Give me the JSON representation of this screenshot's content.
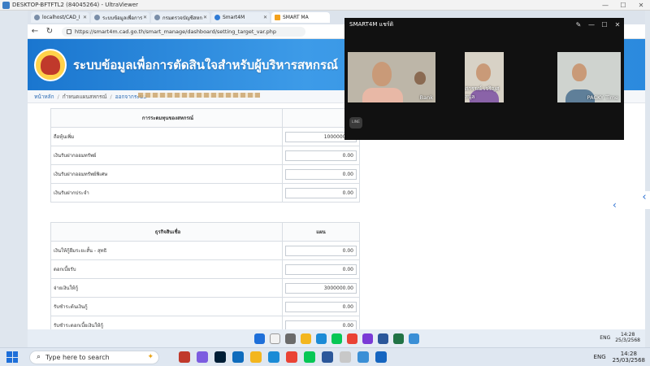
{
  "uv": {
    "title": "DESKTOP-BFTFTL2 (84045264) - UltraViewer"
  },
  "browser": {
    "tabs": [
      {
        "label": "localhost/CAD_I"
      },
      {
        "label": "ระบบข้อมูลเพื่อการ"
      },
      {
        "label": "กรมตรวจบัญชีสหก"
      },
      {
        "label": "Smart4M"
      },
      {
        "label": "SMART MA"
      }
    ],
    "url": "https://smart4m.cad.go.th/smart_manage/dashboard/setting_target_var.php"
  },
  "site": {
    "title": "ระบบข้อมูลเพื่อการตัดสินใจสำหรับผู้บริหารสหกรณ์",
    "breadcrumb": {
      "home": "หน้าหลัก",
      "plan": "กำหนดแผนสหกรณ์",
      "logout": "ออกจากระบบ"
    }
  },
  "section1": {
    "header": "การระดมทุนของสหกรณ์",
    "rows": [
      {
        "label": "ถือหุ้นเพิ่ม",
        "value": "1000000.00"
      },
      {
        "label": "เงินรับฝากออมทรัพย์",
        "value": "0.00"
      },
      {
        "label": "เงินรับฝากออมทรัพย์พิเศษ",
        "value": "0.00"
      },
      {
        "label": "เงินรับฝากประจำ",
        "value": "0.00"
      }
    ]
  },
  "section2": {
    "header": "ธุรกิจสินเชื่อ",
    "plan_header": "แผน",
    "rows": [
      {
        "label": "เงินให้กู้ยืมระยะสั้น - สุทธิ",
        "value": "0.00"
      },
      {
        "label": "ดอกเบี้ยรับ",
        "value": "0.00"
      },
      {
        "label": "จ่ายเงินให้กู้",
        "value": "3000000.00"
      },
      {
        "label": "รับชำระต้นเงินกู้",
        "value": "0.00"
      },
      {
        "label": "รับชำระดอกเบี้ยเงินให้กู้",
        "value": "0.00"
      }
    ]
  },
  "meeting": {
    "title": "SMART4M แชร์ดิ",
    "participants": [
      {
        "name": "Bank"
      },
      {
        "name": "ศกรรณ์ เจริญศสนุล"
      },
      {
        "name": "PACKY Time"
      }
    ],
    "badge": "LINE"
  },
  "remote_taskbar": {
    "lang": "ENG",
    "time": "14:28",
    "date": "25/3/2568"
  },
  "local_taskbar": {
    "search_placeholder": "Type here to search",
    "lang": "ENG",
    "time": "14:28",
    "date": "25/03/2568"
  }
}
